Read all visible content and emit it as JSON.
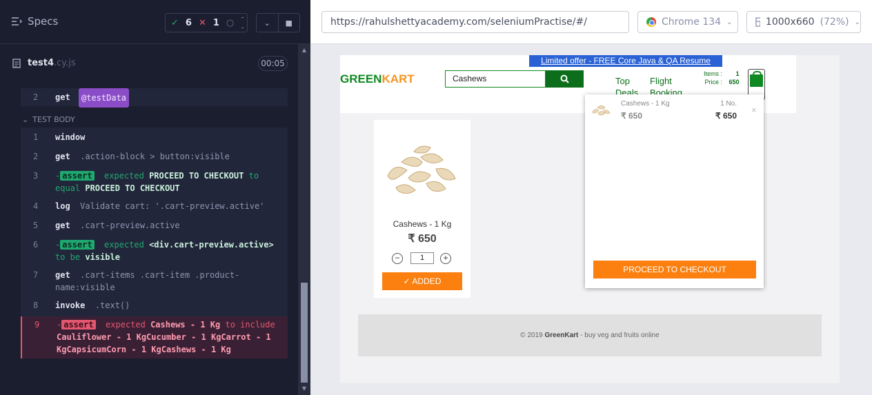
{
  "reporter": {
    "specs_label": "Specs",
    "passed_count": "6",
    "failed_count": "1",
    "pending_label": "--",
    "spec_file": "test4",
    "spec_ext": ".cy.js",
    "duration": "00:05",
    "test_body_label": "TEST BODY"
  },
  "commands": {
    "prev_num": "2",
    "prev_kw": "get",
    "prev_arg": "@testData",
    "c1": {
      "num": "1",
      "kw": "window"
    },
    "c2": {
      "num": "2",
      "kw": "get",
      "arg": ".action-block > button:visible"
    },
    "c3": {
      "num": "3",
      "badge": "assert",
      "t1": "expected",
      "v1": "PROCEED TO CHECKOUT",
      "t2": "to",
      "t3": "equal",
      "v2": "PROCEED TO CHECKOUT"
    },
    "c4": {
      "num": "4",
      "kw": "log",
      "arg": "Validate cart: '.cart-preview.active'"
    },
    "c5": {
      "num": "5",
      "kw": "get",
      "arg": ".cart-preview.active"
    },
    "c6": {
      "num": "6",
      "badge": "assert",
      "t1": "expected",
      "v1": "<div.cart-preview.active>",
      "t2": "to be",
      "v2": "visible"
    },
    "c7": {
      "num": "7",
      "kw": "get",
      "arg": ".cart-items .cart-item .product-name:visible"
    },
    "c8": {
      "num": "8",
      "kw": "invoke",
      "arg": ".text()"
    },
    "c9": {
      "num": "9",
      "badge": "assert",
      "t1": "expected",
      "v1": "Cashews - 1 Kg",
      "t2": "to include",
      "v2": "Cauliflower - 1 KgCucumber - 1 KgCarrot - 1 KgCapsicumCorn - 1 KgCashews - 1 Kg"
    }
  },
  "browser": {
    "url": "https://rahulshettyacademy.com/seleniumPractise/#/",
    "name": "Chrome 134",
    "viewport": "1000x660",
    "scale": "(72%)"
  },
  "site": {
    "offer": "Limited offer - FREE Core Java & QA Resume course",
    "logo_green": "GREEN",
    "logo_orange": "KART",
    "search_value": "Cashews",
    "nav_top_1": "Top",
    "nav_top_2": "Deals",
    "nav_flight_1": "Flight",
    "nav_flight_2": "Booking",
    "items_label": "Items",
    "items_value": "1",
    "price_label": "Price",
    "price_value": "650",
    "product_name": "Cashews - 1 Kg",
    "product_price": "₹ 650",
    "qty": "1",
    "added_label": "✓ ADDED",
    "footer_copy": "© 2019",
    "footer_brand": "GreenKart",
    "footer_tail": "- buy veg and fruits online"
  },
  "cart_preview": {
    "item_name": "Cashews - 1 Kg",
    "item_price": "₹ 650",
    "item_qty": "1 No.",
    "item_amount": "₹ 650",
    "close": "×",
    "checkout_label": "PROCEED TO CHECKOUT"
  }
}
